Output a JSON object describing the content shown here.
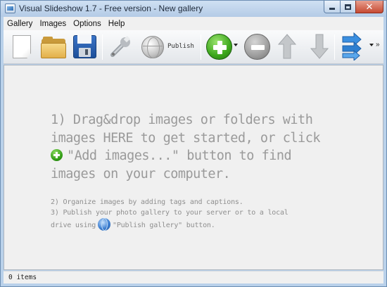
{
  "window": {
    "title": "Visual Slideshow 1.7 - Free version - New gallery",
    "buttons": {
      "close_glyph": "✕"
    }
  },
  "menu": {
    "items": [
      {
        "label": "Gallery"
      },
      {
        "label": "Images"
      },
      {
        "label": "Options"
      },
      {
        "label": "Help"
      }
    ]
  },
  "toolbar": {
    "publish_label": "Publish",
    "overflow_glyph": "»",
    "icons": [
      "new-gallery-icon",
      "open-folder-icon",
      "save-disk-icon",
      "wrench-icon",
      "globe-icon",
      "add-plus-icon",
      "remove-minus-icon",
      "arrow-up-icon",
      "arrow-down-icon",
      "move-arrow-icon"
    ],
    "colors": {
      "add": "#3da71c",
      "remove": "#9e9e9e",
      "move": "#2e7fd0"
    }
  },
  "main": {
    "hint_lines": [
      "1) Drag&drop images or folders with",
      "images HERE to get started, or click",
      "\"Add images...\" button to find",
      "images on your computer."
    ],
    "tips": [
      "2) Organize images by adding tags and captions.",
      "3) Publish your photo gallery to your server or to a local",
      "drive using",
      "\"Publish gallery\" button."
    ]
  },
  "status": {
    "items_text": "0 items"
  }
}
